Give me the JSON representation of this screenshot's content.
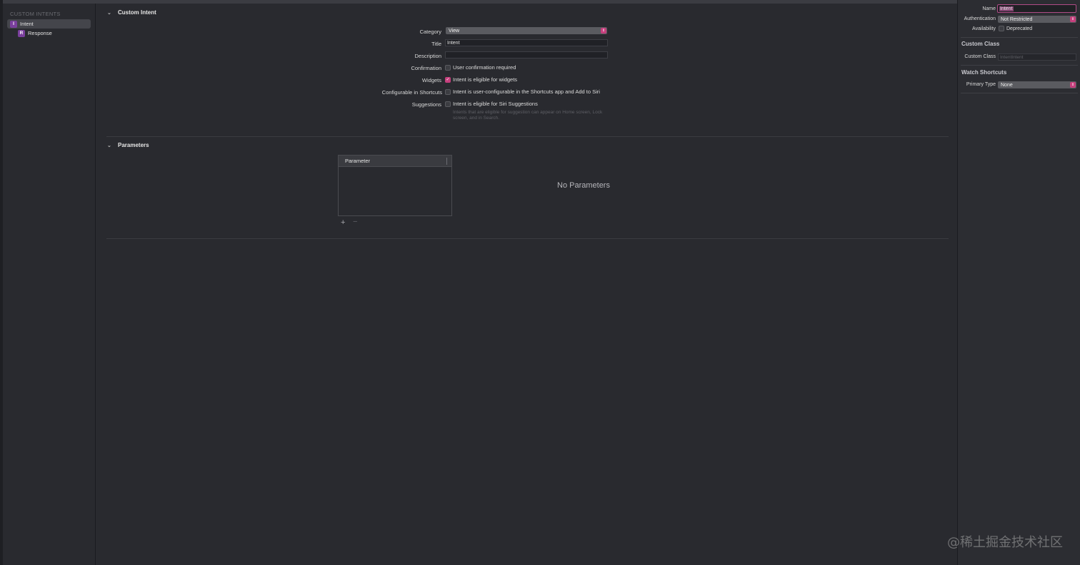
{
  "sidebar": {
    "heading": "CUSTOM INTENTS",
    "items": [
      {
        "badge": "I",
        "label": "Intent",
        "selected": true
      },
      {
        "badge": "R",
        "label": "Response",
        "selected": false
      }
    ]
  },
  "custom_intent": {
    "section_title": "Custom Intent",
    "category_label": "Category",
    "category_value": "View",
    "title_label": "Title",
    "title_value": "Intent",
    "description_label": "Description",
    "description_value": "",
    "confirmation_label": "Confirmation",
    "confirmation_text": "User confirmation required",
    "confirmation_checked": false,
    "widgets_label": "Widgets",
    "widgets_text": "Intent is eligible for widgets",
    "widgets_checked": true,
    "configurable_label": "Configurable in Shortcuts",
    "configurable_text": "Intent is user-configurable in the Shortcuts app and Add to Siri",
    "configurable_checked": false,
    "suggestions_label": "Suggestions",
    "suggestions_text": "Intent is eligible for Siri Suggestions",
    "suggestions_checked": false,
    "suggestions_hint": "Intents that are eligible for suggestion can appear on Home screen, Lock screen, and in Search."
  },
  "parameters": {
    "section_title": "Parameters",
    "column_header": "Parameter",
    "add_symbol": "+",
    "remove_symbol": "−",
    "empty_text": "No Parameters"
  },
  "inspector": {
    "name_label": "Name",
    "name_value": "Intent",
    "authentication_label": "Authentication",
    "authentication_value": "Not Restricted",
    "availability_label": "Availability",
    "deprecated_text": "Deprecated",
    "custom_class_section": "Custom Class",
    "custom_class_label": "Custom Class",
    "custom_class_placeholder": "IntentIntent",
    "watch_section": "Watch Shortcuts",
    "primary_type_label": "Primary Type",
    "primary_type_value": "None"
  },
  "watermark": "@稀土掘金技术社区",
  "colors": {
    "accent": "#c63f7d",
    "badge": "#7a3f9d",
    "background": "#292a2f"
  },
  "icons": {
    "section_chevron": "chevron-down-icon",
    "popup_stepper": "up-down-stepper-icon",
    "check": "checkmark-icon"
  }
}
